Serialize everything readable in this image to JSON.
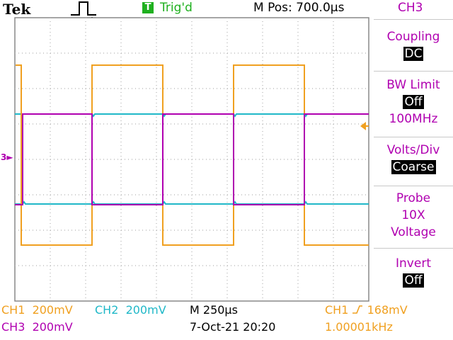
{
  "header": {
    "brand": "Tek",
    "trigger_badge": "T",
    "trigger_status": "Trig'd",
    "m_pos": "M Pos: 700.0µs",
    "channel_title": "CH3"
  },
  "menu": {
    "coupling_label": "Coupling",
    "coupling_value": "DC",
    "bw_label": "BW Limit",
    "bw_value": "Off",
    "bw_freq": "100MHz",
    "voltsdiv_label": "Volts/Div",
    "voltsdiv_value": "Coarse",
    "probe_label": "Probe",
    "probe_atten": "10X",
    "probe_type": "Voltage",
    "invert_label": "Invert",
    "invert_value": "Off"
  },
  "status": {
    "ch1": "CH1",
    "ch1_scale": "200mV",
    "ch2": "CH2",
    "ch2_scale": "200mV",
    "timebase": "M 250µs",
    "trigger_source": "CH1",
    "trigger_level": "168mV",
    "ch3": "CH3",
    "ch3_scale": "200mV",
    "datetime": "7-Oct-21 20:20",
    "frequency": "1.00001kHz"
  },
  "markers": {
    "ch3_marker": "3"
  },
  "colors": {
    "ch1": "#f0a020",
    "ch2": "#20b8c8",
    "ch3": "#b000b0",
    "trig": "#1fb01f"
  }
}
